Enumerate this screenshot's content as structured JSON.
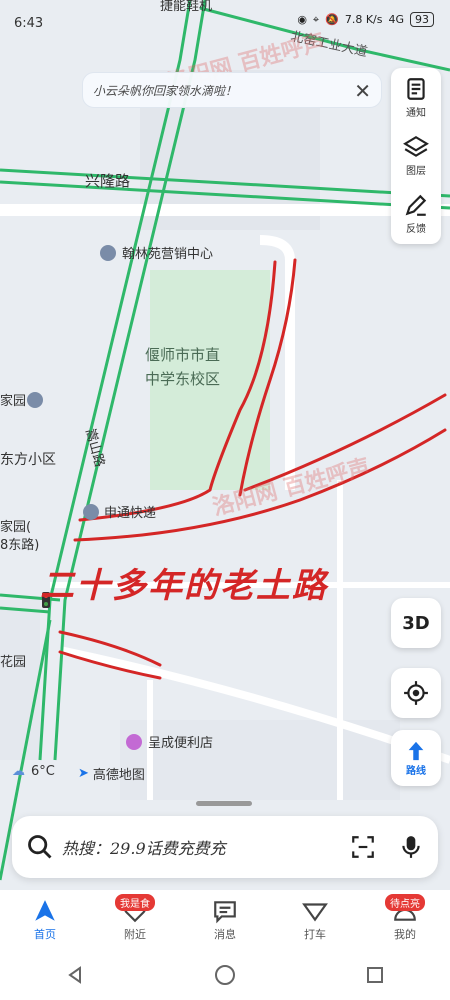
{
  "status": {
    "time": "6:43",
    "speed": "7.8 K/s",
    "network": "4G",
    "battery": "93"
  },
  "notice": {
    "text": "小云朵帆你回家领水滴啦！",
    "close": "✕"
  },
  "toolbar": [
    {
      "label": "通知",
      "icon": "notification-icon"
    },
    {
      "label": "图层",
      "icon": "layers-icon"
    },
    {
      "label": "反馈",
      "icon": "feedback-icon"
    }
  ],
  "map": {
    "labels": [
      {
        "text": "捷能鞋机"
      },
      {
        "text": "北窑工业大道"
      },
      {
        "text": "兴隆路"
      },
      {
        "text": "翰林苑营销中心"
      },
      {
        "text": "偃师市市直"
      },
      {
        "text": "中学东校区"
      },
      {
        "text": "家园"
      },
      {
        "text": "嵩山路"
      },
      {
        "text": "东方小区"
      },
      {
        "text": "申通快递"
      },
      {
        "text": "家园("
      },
      {
        "text": "8东路)"
      },
      {
        "text": "花园"
      },
      {
        "text": "呈成便利店"
      }
    ],
    "handwriting": "二十多年的老土路",
    "watermark": "洛阳网 百姓呼声"
  },
  "controls": {
    "three_d": "3D",
    "route": "路线"
  },
  "weather": {
    "temp": "6°C"
  },
  "brand": {
    "name": "高德地图"
  },
  "search": {
    "placeholder": "热搜：29.9话费充费充"
  },
  "nav": [
    {
      "label": "首页",
      "badge": ""
    },
    {
      "label": "附近",
      "badge": "我是食"
    },
    {
      "label": "消息",
      "badge": ""
    },
    {
      "label": "打车",
      "badge": ""
    },
    {
      "label": "我的",
      "badge": "待点亮"
    }
  ],
  "colors": {
    "accent": "#1a73e8",
    "road_green": "#2fb86a",
    "ink_red": "#d42626",
    "park_green": "#d4ecd9"
  }
}
